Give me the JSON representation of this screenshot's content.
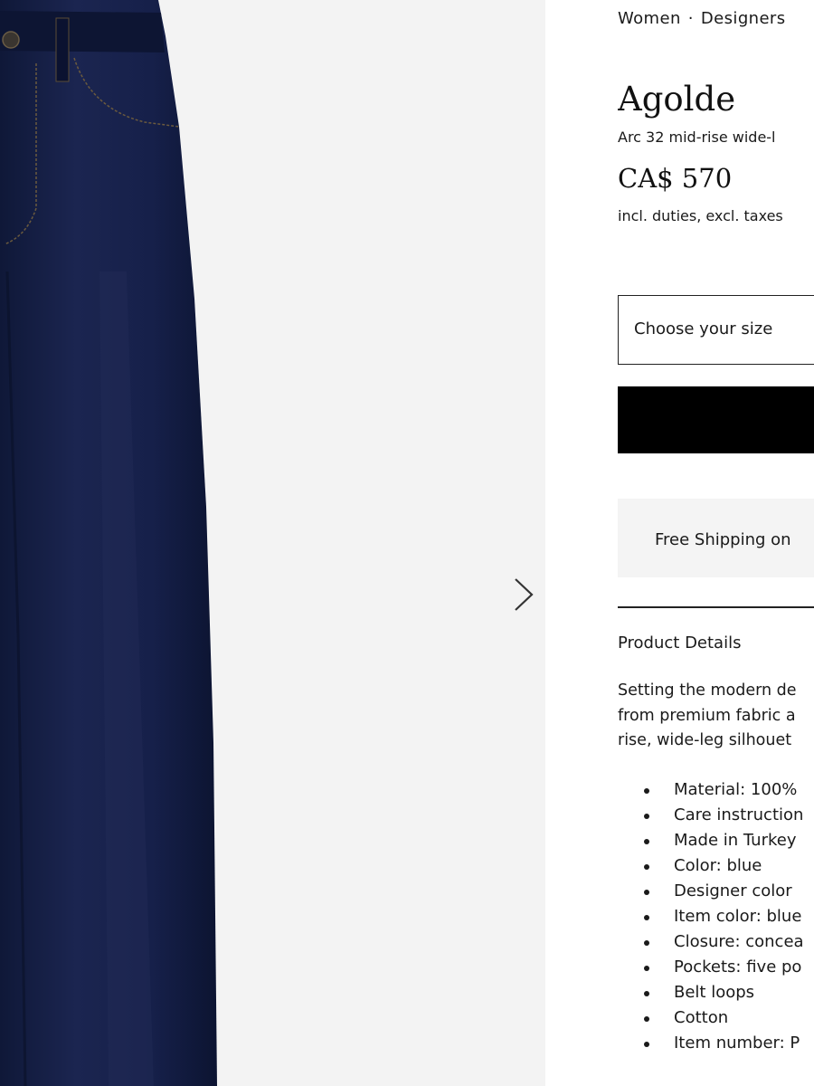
{
  "breadcrumb": {
    "items": [
      "Women",
      "Designers"
    ],
    "separator": "·"
  },
  "product": {
    "brand": "Agolde",
    "subtitle": "Arc 32 mid-rise wide-l",
    "price": "CA$ 570",
    "price_note": "incl. duties, excl. taxes"
  },
  "size_select": {
    "placeholder": "Choose your size"
  },
  "shipping": {
    "text": "Free Shipping on"
  },
  "details": {
    "heading": "Product Details",
    "description_lines": [
      "Setting the modern de",
      "from premium fabric a",
      "rise, wide-leg silhouet"
    ],
    "features": [
      "Material: 100%",
      "Care instruction",
      "Made in Turkey",
      "Color: blue",
      "Designer color",
      "Item color: blue",
      "Closure: concea",
      "Pockets: five po",
      "Belt loops",
      "Cotton",
      "Item number: P"
    ]
  },
  "gallery": {
    "image_subject": "dark indigo wide-leg jeans",
    "next_icon": "chevron-right-icon"
  },
  "colors": {
    "denim": "#141d3f",
    "background": "#f3f3f3",
    "button": "#000000",
    "shipping_bar": "#f4f4f4"
  }
}
